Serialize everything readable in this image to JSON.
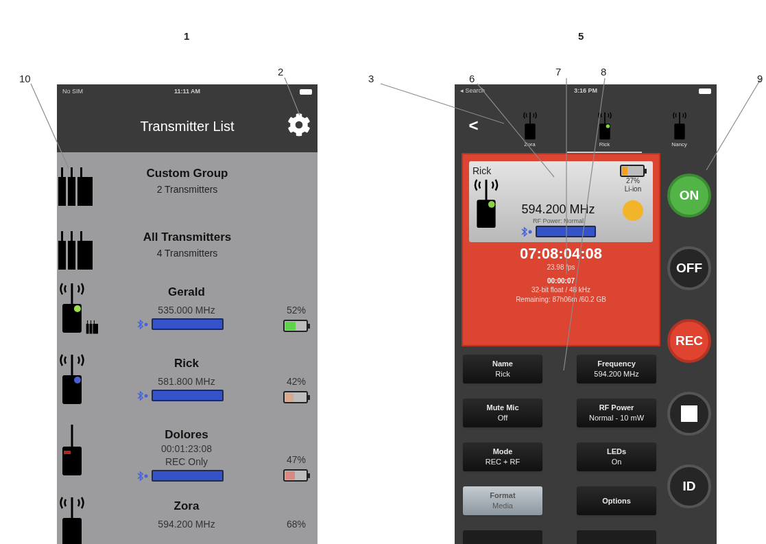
{
  "callouts": [
    {
      "label": "1"
    },
    {
      "label": "5"
    },
    {
      "label": "10"
    },
    {
      "label": "2"
    },
    {
      "label": "3"
    },
    {
      "label": "6"
    },
    {
      "label": "7"
    },
    {
      "label": "8"
    },
    {
      "label": "9"
    }
  ],
  "list_screen": {
    "status_bar": {
      "carrier": "No SIM",
      "time": "11:11 AM"
    },
    "title": "Transmitter List",
    "groups": [
      {
        "name": "Custom Group",
        "count": "2 Transmitters"
      },
      {
        "name": "All Transmitters",
        "count": "4 Transmitters"
      }
    ],
    "transmitters": [
      {
        "kind": "rf",
        "name": "Gerald",
        "lines": [
          "535.000 MHz"
        ],
        "color": "#9be04a",
        "in_group": true,
        "meter": true,
        "battery": {
          "reading": "52%",
          "level": 0.52,
          "color": "#5ed24a"
        }
      },
      {
        "kind": "rf",
        "name": "Rick",
        "lines": [
          "581.800 MHz"
        ],
        "color": "#4a5fd0",
        "in_group": false,
        "meter": true,
        "battery": {
          "reading": "42%",
          "level": 0.42,
          "color": "#d9a98e"
        }
      },
      {
        "kind": "rec",
        "name": "Dolores",
        "lines": [
          "00:01:23:08",
          "REC Only"
        ],
        "in_group": false,
        "meter": true,
        "battery": {
          "reading": "47%",
          "level": 0.47,
          "color": "#d98a80"
        }
      },
      {
        "kind": "rf",
        "name": "Zora",
        "lines": [
          "594.200 MHz"
        ],
        "in_group": false,
        "meter": false,
        "battery": {
          "reading": "68%"
        }
      }
    ]
  },
  "detail_screen": {
    "status_bar": {
      "back": "◂ Search",
      "time": "3:16 PM"
    },
    "back_button": "<",
    "device_tabs": [
      {
        "name": "Zora",
        "selected": false
      },
      {
        "name": "Rick",
        "selected": true
      },
      {
        "name": "Nancy",
        "selected": false
      }
    ],
    "card": {
      "name": "Rick",
      "frequency": "594.200 MHz",
      "rf_power": "RF Power: Normal",
      "battery": {
        "reading": "27%",
        "level": 0.27,
        "color": "#f0a020"
      },
      "battery_type": "Li-ion"
    },
    "timecode": "07:08:04:08",
    "fps": "23.98 fps",
    "elapsed": "00:00:07",
    "format": "32-bit float / 48 kHz",
    "remaining": "Remaining: 87h06m /60.2 GB",
    "settings": [
      {
        "label": "Name",
        "value": "Rick",
        "kind": "dark"
      },
      {
        "label": "Frequency",
        "value": "594.200 MHz",
        "kind": "dark"
      },
      {
        "label": "Mute Mic",
        "value": "Off",
        "kind": "dark"
      },
      {
        "label": "RF Power",
        "value": "Normal - 10 mW",
        "kind": "dark"
      },
      {
        "label": "Mode",
        "value": "REC + RF",
        "kind": "dark"
      },
      {
        "label": "LEDs",
        "value": "On",
        "kind": "dark"
      },
      {
        "label": "Format",
        "value": "Media",
        "kind": "light"
      },
      {
        "label": "Options",
        "kind": "dark"
      }
    ],
    "side_buttons": [
      {
        "kind": "on",
        "label": "ON"
      },
      {
        "kind": "off",
        "label": "OFF"
      },
      {
        "kind": "rec",
        "label": "REC"
      },
      {
        "kind": "stop"
      },
      {
        "kind": "id",
        "label": "ID"
      }
    ]
  }
}
